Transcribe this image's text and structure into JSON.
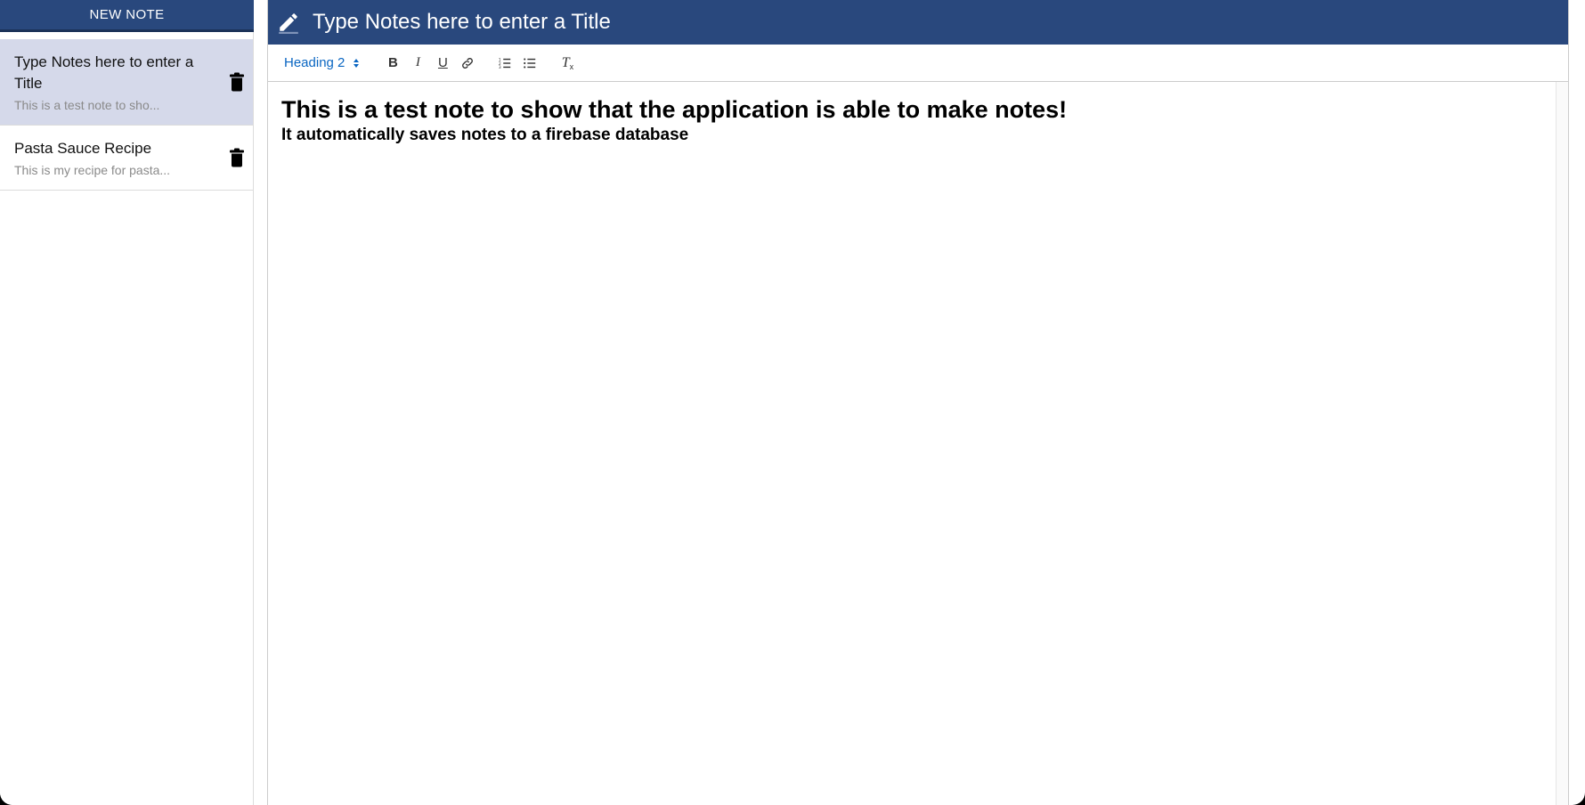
{
  "sidebar": {
    "new_note_label": "NEW NOTE",
    "notes": [
      {
        "title": "Type Notes here to enter a Title",
        "preview": "This is a test note to sho...",
        "selected": true
      },
      {
        "title": "Pasta Sauce Recipe",
        "preview": "This is my recipe for pasta...",
        "selected": false
      }
    ]
  },
  "editor": {
    "title_value": "Type Notes here to enter a Title",
    "toolbar": {
      "heading_select": "Heading 2",
      "bold": "B",
      "italic": "I",
      "underline": "U",
      "clean": "T"
    },
    "content": {
      "heading": "This is a test note to show that the application is able to make notes!",
      "subheading": "It automatically saves notes to a firebase database"
    }
  },
  "colors": {
    "primary": "#29487d",
    "selected_item_bg": "#d5d9ea",
    "link_blue": "#0a66c2"
  },
  "icons": [
    "pencil-icon",
    "trash-icon",
    "link-icon",
    "ordered-list-icon",
    "bullet-list-icon",
    "clear-format-icon"
  ]
}
